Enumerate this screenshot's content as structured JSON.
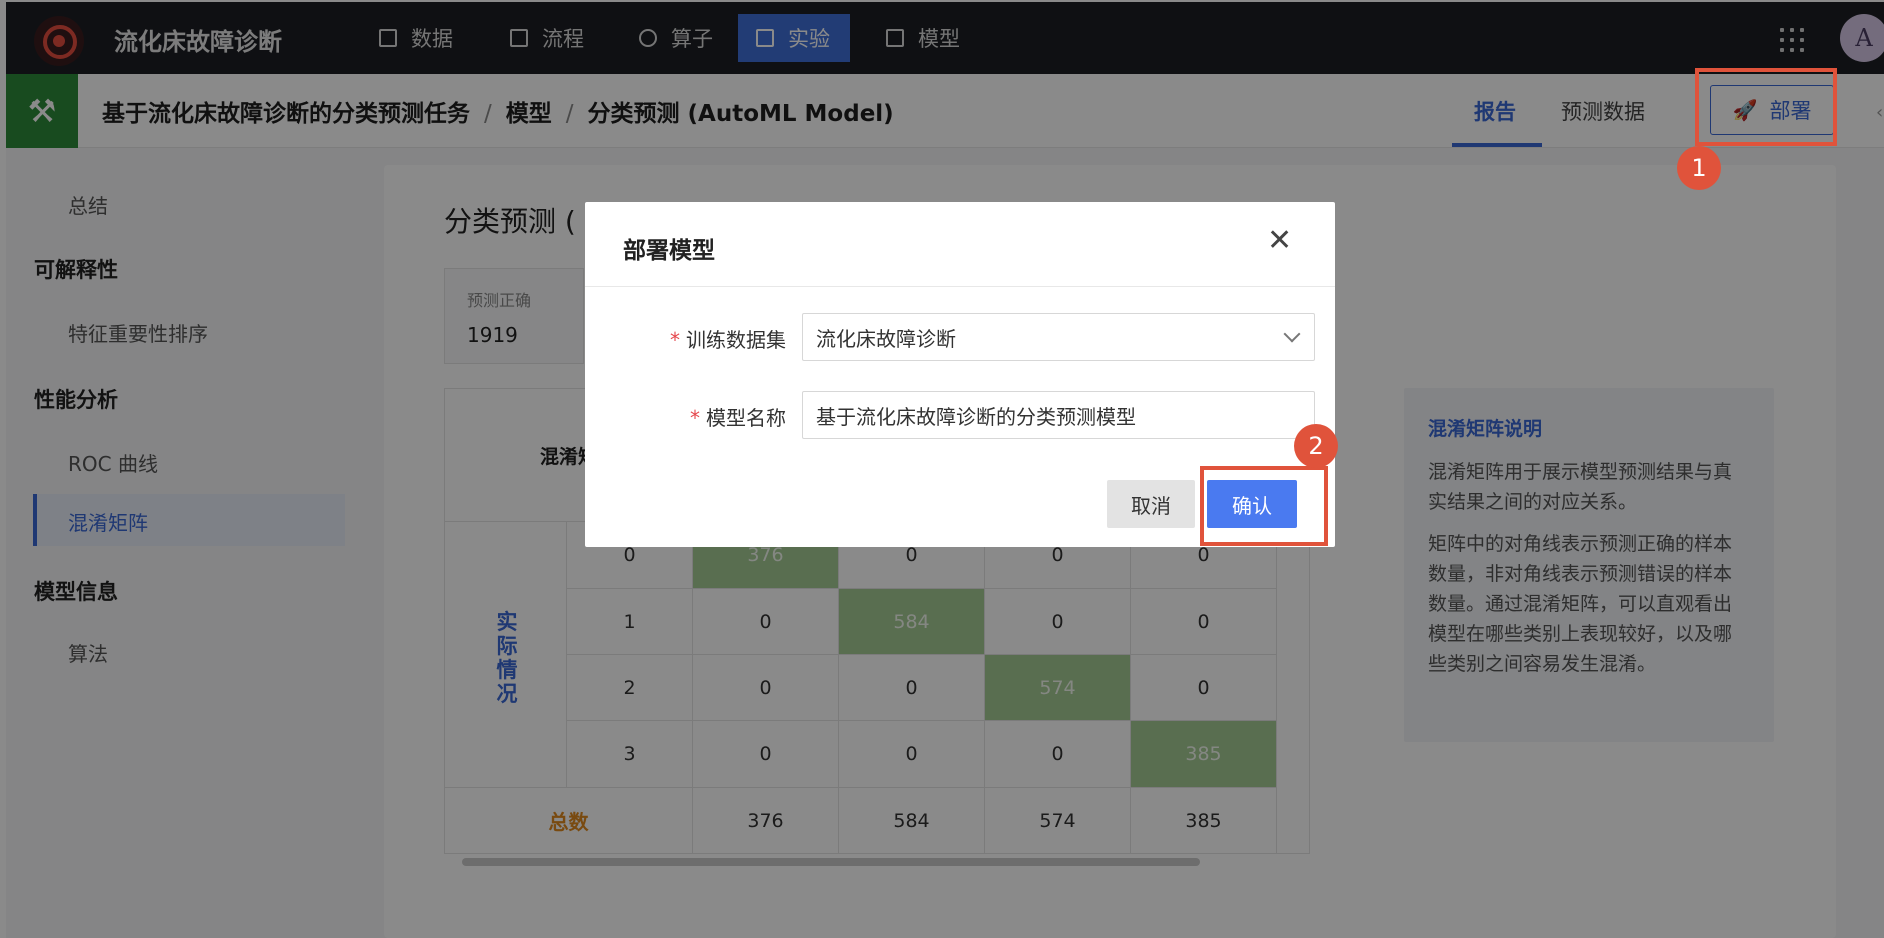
{
  "app": {
    "title": "流化床故障诊断",
    "nav": [
      {
        "label": "数据",
        "icon": "table-icon"
      },
      {
        "label": "流程",
        "icon": "flow-icon"
      },
      {
        "label": "算子",
        "icon": "operator-icon"
      },
      {
        "label": "实验",
        "icon": "cube-icon"
      },
      {
        "label": "模型",
        "icon": "save-icon"
      }
    ],
    "active_nav": "实验",
    "avatar": "A"
  },
  "header": {
    "breadcrumb": [
      "基于流化床故障诊断的分类预测任务",
      "模型",
      "分类预测 (AutoML Model)"
    ],
    "separator": "/",
    "tabs": [
      "报告",
      "预测数据"
    ],
    "active_tab": "报告",
    "deploy_label": "部署"
  },
  "sidebar": {
    "items": [
      {
        "label": "总结"
      },
      {
        "label": "可解释性"
      },
      {
        "label": "特征重要性排序"
      },
      {
        "label": "性能分析"
      },
      {
        "label": "ROC 曲线"
      },
      {
        "label": "混淆矩阵"
      },
      {
        "label": "模型信息"
      },
      {
        "label": "算法"
      }
    ],
    "active": "混淆矩阵"
  },
  "main": {
    "title": "分类预测 (",
    "stat": {
      "label": "预测正确",
      "value": "1919"
    },
    "matrix": {
      "header": "混淆矩",
      "row_axis_label": "实际情况",
      "rows": [
        {
          "label": "0",
          "values": [
            "376",
            "0",
            "0",
            "0"
          ]
        },
        {
          "label": "1",
          "values": [
            "0",
            "584",
            "0",
            "0"
          ]
        },
        {
          "label": "2",
          "values": [
            "0",
            "0",
            "574",
            "0"
          ]
        },
        {
          "label": "3",
          "values": [
            "0",
            "0",
            "0",
            "385"
          ]
        }
      ],
      "total_label": "总数",
      "totals": [
        "376",
        "584",
        "574",
        "385"
      ]
    },
    "explain": {
      "title": "混淆矩阵说明",
      "p1": "混淆矩阵用于展示模型预测结果与真实结果之间的对应关系。",
      "p2": "矩阵中的对角线表示预测正确的样本数量，非对角线表示预测错误的样本数量。通过混淆矩阵，可以直观看出模型在哪些类别上表现较好，以及哪些类别之间容易发生混淆。"
    }
  },
  "modal": {
    "title": "部署模型",
    "fields": [
      {
        "label": "训练数据集",
        "value": "流化床故障诊断",
        "type": "select"
      },
      {
        "label": "模型名称",
        "value": "基于流化床故障诊断的分类预测模型",
        "type": "text"
      }
    ],
    "required_mark": "*",
    "cancel_label": "取消",
    "confirm_label": "确认"
  },
  "callouts": [
    "1",
    "2"
  ],
  "colors": {
    "accent": "#3a68d4",
    "callout": "#e0533b",
    "diagonal": "#a5cc95",
    "topbar": "#1d1f24"
  }
}
